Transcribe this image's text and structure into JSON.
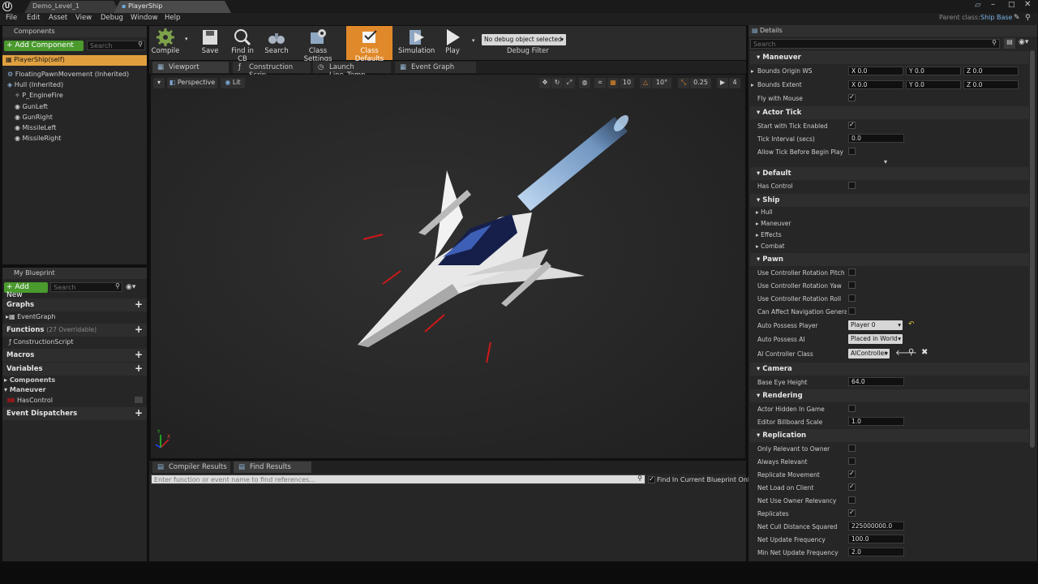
{
  "titlebar": {
    "tabs": [
      "Demo_Level_1",
      "PlayerShip"
    ],
    "parent_class_label": "Parent class:",
    "parent_class_value": "Ship Base"
  },
  "menubar": {
    "items": [
      "File",
      "Edit",
      "Asset",
      "View",
      "Debug",
      "Window",
      "Help"
    ]
  },
  "components": {
    "title": "Components",
    "add_label": "+ Add Component",
    "search_placeholder": "Search",
    "items": [
      "PlayerShip(self)",
      "FloatingPawnMovement (Inherited)",
      "Hull (Inherited)",
      "P_EngineFire",
      "GunLeft",
      "GunRight",
      "MissileLeft",
      "MissileRight"
    ]
  },
  "toolbar": {
    "buttons": [
      "Compile",
      "Save",
      "Find in CB",
      "Search",
      "Class Settings",
      "Class Defaults",
      "Simulation",
      "Play"
    ],
    "debug_object": "No debug object selected",
    "debug_filter": "Debug Filter"
  },
  "viewport": {
    "tabs": [
      "Viewport",
      "Construction Scrip",
      "Launch Line_Temp",
      "Event Graph"
    ],
    "perspective": "Perspective",
    "lit": "Lit",
    "snap_grid": "10",
    "snap_rot": "10°",
    "snap_scale": "0.25",
    "cam_speed": "4",
    "axis_x": "X",
    "axis_y": "Y"
  },
  "my_blueprint": {
    "title": "My Blueprint",
    "add_label": "+ Add New",
    "search_placeholder": "Search",
    "sections": {
      "graphs": "Graphs",
      "functions": "Functions",
      "functions_count": "(27 Overridable)",
      "macros": "Macros",
      "variables": "Variables",
      "dispatchers": "Event Dispatchers"
    },
    "graph_items": [
      "EventGraph"
    ],
    "function_items": [
      "ConstructionScript"
    ],
    "variable_groups": [
      "Components",
      "Maneuver"
    ],
    "variable_items": [
      "HasControl"
    ]
  },
  "results": {
    "tabs": [
      "Compiler Results",
      "Find Results"
    ],
    "find_placeholder": "Enter function or event name to find references...",
    "find_current_label": "Find In Current Blueprint Only"
  },
  "details": {
    "title": "Details",
    "search_placeholder": "Search",
    "maneuver": {
      "title": "Maneuver",
      "bounds_origin_label": "Bounds Origin WS",
      "bounds_extent_label": "Bounds Extent",
      "x": "X",
      "y": "Y",
      "z": "Z",
      "origin": [
        "0.0",
        "0.0",
        "0.0"
      ],
      "extent": [
        "0.0",
        "0.0",
        "0.0"
      ],
      "fly_with_mouse_label": "Fly with Mouse"
    },
    "actor_tick": {
      "title": "Actor Tick",
      "start_label": "Start with Tick Enabled",
      "interval_label": "Tick Interval (secs)",
      "interval_value": "0.0",
      "allow_label": "Allow Tick Before Begin Play"
    },
    "default": {
      "title": "Default",
      "has_control_label": "Has Control"
    },
    "ship": {
      "title": "Ship",
      "items": [
        "Hull",
        "Maneuver",
        "Effects",
        "Combat"
      ]
    },
    "pawn": {
      "title": "Pawn",
      "pitch_label": "Use Controller Rotation Pitch",
      "yaw_label": "Use Controller Rotation Yaw",
      "roll_label": "Use Controller Rotation Roll",
      "nav_label": "Can Affect Navigation Generation",
      "auto_player_label": "Auto Possess Player",
      "auto_player_value": "Player 0",
      "auto_ai_label": "Auto Possess AI",
      "auto_ai_value": "Placed in World",
      "ai_class_label": "AI Controller Class",
      "ai_class_value": "AIController"
    },
    "camera": {
      "title": "Camera",
      "eye_label": "Base Eye Height",
      "eye_value": "64.0"
    },
    "rendering": {
      "title": "Rendering",
      "hidden_label": "Actor Hidden In Game",
      "billboard_label": "Editor Billboard Scale",
      "billboard_value": "1.0"
    },
    "replication": {
      "title": "Replication",
      "only_owner": "Only Relevant to Owner",
      "always": "Always Relevant",
      "movement": "Replicate Movement",
      "load_client": "Net Load on Client",
      "owner_relevancy": "Net Use Owner Relevancy",
      "replicates": "Replicates",
      "cull_label": "Net Cull Distance Squared",
      "cull_value": "225000000.0",
      "freq_label": "Net Update Frequency",
      "freq_value": "100.0",
      "min_freq_label": "Min Net Update Frequency",
      "min_freq_value": "2.0"
    }
  },
  "colors": {
    "accent_green": "#4a9a2e",
    "active_orange": "#e0892a",
    "panel": "#262626"
  }
}
